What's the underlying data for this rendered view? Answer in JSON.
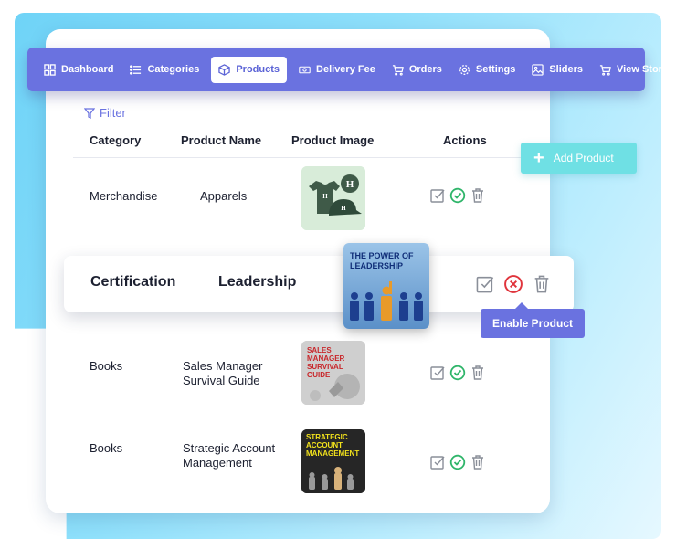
{
  "nav": {
    "items": [
      {
        "label": "Dashboard",
        "icon": "dashboard-icon"
      },
      {
        "label": "Categories",
        "icon": "list-icon"
      },
      {
        "label": "Products",
        "icon": "box-icon",
        "active": true
      },
      {
        "label": "Delivery Fee",
        "icon": "money-icon"
      },
      {
        "label": "Orders",
        "icon": "cart-icon"
      },
      {
        "label": "Settings",
        "icon": "gear-icon"
      },
      {
        "label": "Sliders",
        "icon": "image-icon"
      },
      {
        "label": "View Store",
        "icon": "cart-icon"
      }
    ]
  },
  "filter_label": "Filter",
  "add_product_label": "Add Product",
  "table": {
    "headers": [
      "Category",
      "Product Name",
      "Product Image",
      "Actions"
    ],
    "rows": [
      {
        "category": "Merchandise",
        "name": "Apparels",
        "image_text": ""
      },
      {
        "category": "Certification",
        "name": "Leadership",
        "image_text": "THE POWER OF LEADERSHIP",
        "highlighted": true
      },
      {
        "category": "Books",
        "name_line1": "Sales Manager",
        "name_line2": "Survival Guide",
        "image_text": "SALES MANAGER SURVIVAL GUIDE"
      },
      {
        "category": "Books",
        "name_line1": "Strategic Account",
        "name_line2": "Management",
        "image_text": "STRATEGIC ACCOUNT MANAGEMENT"
      }
    ]
  },
  "tooltip": "Enable Product",
  "colors": {
    "accent": "#6a72e0",
    "teal": "#6fe0e4",
    "green": "#2fb56a",
    "red": "#e0343c"
  }
}
